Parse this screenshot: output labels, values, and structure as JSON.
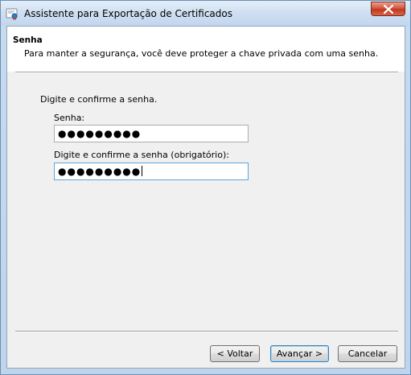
{
  "window": {
    "title": "Assistente para Exportação de Certificados",
    "icon": "certificate-icon",
    "close_icon": "close-icon"
  },
  "header": {
    "title": "Senha",
    "description": "Para manter a segurança, você deve proteger a chave privada com uma senha."
  },
  "form": {
    "instruction": "Digite e confirme a senha.",
    "password_label": "Senha:",
    "password_value": "●●●●●●●●●",
    "confirm_label": "Digite e confirme a senha (obrigatório):",
    "confirm_value": "●●●●●●●●●"
  },
  "buttons": {
    "back": "< Voltar",
    "next": "Avançar >",
    "cancel": "Cancelar"
  },
  "colors": {
    "close_button": "#c0391d",
    "focus_border": "#5ea3dc"
  }
}
